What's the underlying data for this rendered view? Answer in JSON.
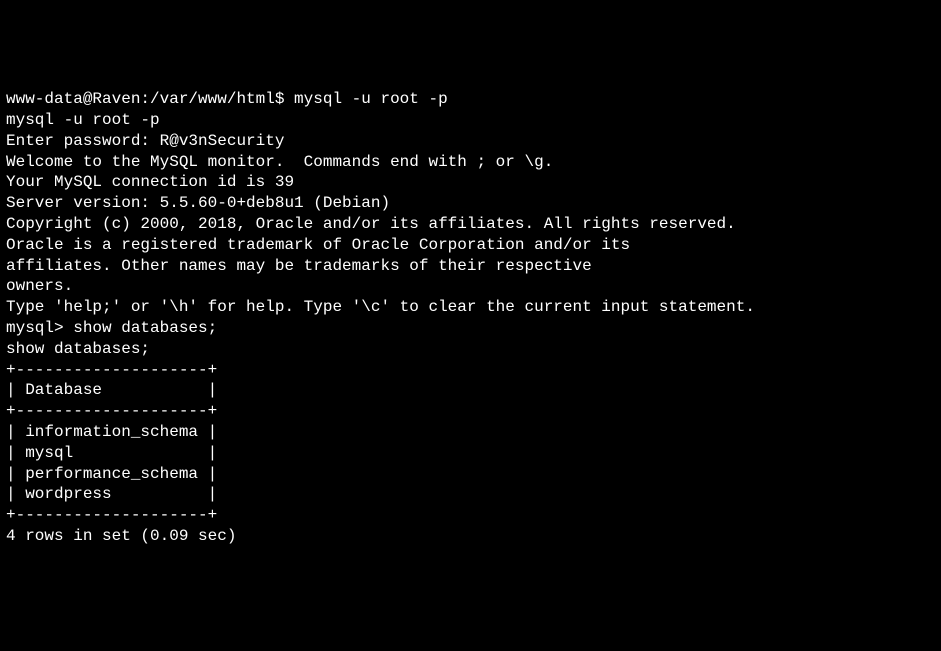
{
  "terminal": {
    "lines": [
      "www-data@Raven:/var/www/html$ mysql -u root -p",
      "mysql -u root -p",
      "Enter password: R@v3nSecurity",
      "",
      "Welcome to the MySQL monitor.  Commands end with ; or \\g.",
      "Your MySQL connection id is 39",
      "Server version: 5.5.60-0+deb8u1 (Debian)",
      "",
      "Copyright (c) 2000, 2018, Oracle and/or its affiliates. All rights reserved.",
      "",
      "Oracle is a registered trademark of Oracle Corporation and/or its",
      "affiliates. Other names may be trademarks of their respective",
      "owners.",
      "",
      "Type 'help;' or '\\h' for help. Type '\\c' to clear the current input statement.",
      "",
      "mysql> show databases;",
      "show databases;",
      "+--------------------+",
      "| Database           |",
      "+--------------------+",
      "| information_schema |",
      "| mysql              |",
      "| performance_schema |",
      "| wordpress          |",
      "+--------------------+",
      "4 rows in set (0.09 sec)"
    ]
  },
  "session": {
    "prompt": "www-data@Raven:/var/www/html$",
    "user": "www-data",
    "host": "Raven",
    "cwd": "/var/www/html",
    "command": "mysql -u root -p",
    "password_entered": "R@v3nSecurity",
    "mysql_prompt": "mysql>",
    "mysql_command": "show databases;"
  },
  "mysql": {
    "connection_id": 39,
    "server_version": "5.5.60-0+deb8u1 (Debian)",
    "databases": [
      "information_schema",
      "mysql",
      "performance_schema",
      "wordpress"
    ],
    "row_count": 4,
    "query_time": "0.09 sec"
  }
}
